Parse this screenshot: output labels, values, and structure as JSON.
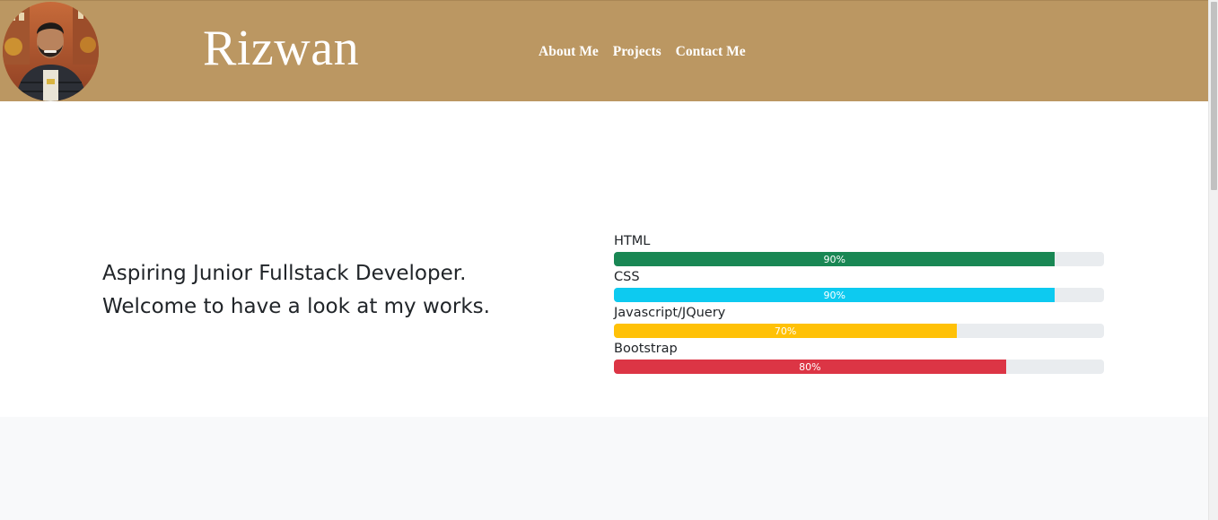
{
  "header": {
    "brand": "Rizwan",
    "nav": [
      {
        "label": "About Me"
      },
      {
        "label": "Projects"
      },
      {
        "label": "Contact Me"
      }
    ]
  },
  "hero": {
    "tagline_line1": "Aspiring Junior Fullstack Developer.",
    "tagline_line2": "Welcome to have a look at my works."
  },
  "skills": [
    {
      "name": "HTML",
      "percent": 90,
      "percent_label": "90%",
      "color": "#198754"
    },
    {
      "name": "CSS",
      "percent": 90,
      "percent_label": "90%",
      "color": "#0dcaf0"
    },
    {
      "name": "Javascript/JQuery",
      "percent": 70,
      "percent_label": "70%",
      "color": "#ffc107"
    },
    {
      "name": "Bootstrap",
      "percent": 80,
      "percent_label": "80%",
      "color": "#dc3545"
    }
  ],
  "colors": {
    "header_bg": "#bb9762",
    "track_bg": "#e9ecef",
    "section_bg": "#f8f9fa"
  }
}
